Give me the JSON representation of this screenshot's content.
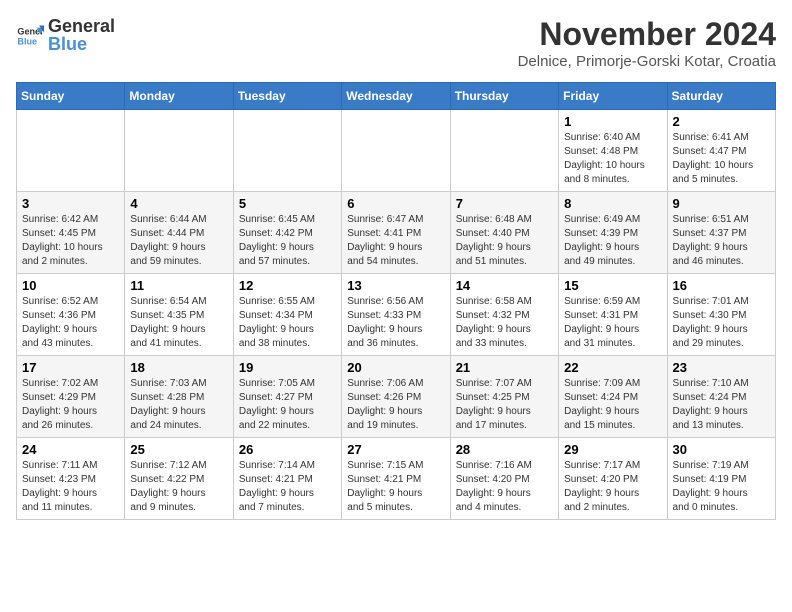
{
  "header": {
    "logo_general": "General",
    "logo_blue": "Blue",
    "month_title": "November 2024",
    "location": "Delnice, Primorje-Gorski Kotar, Croatia"
  },
  "weekdays": [
    "Sunday",
    "Monday",
    "Tuesday",
    "Wednesday",
    "Thursday",
    "Friday",
    "Saturday"
  ],
  "weeks": [
    [
      {
        "day": "",
        "info": ""
      },
      {
        "day": "",
        "info": ""
      },
      {
        "day": "",
        "info": ""
      },
      {
        "day": "",
        "info": ""
      },
      {
        "day": "",
        "info": ""
      },
      {
        "day": "1",
        "info": "Sunrise: 6:40 AM\nSunset: 4:48 PM\nDaylight: 10 hours\nand 8 minutes."
      },
      {
        "day": "2",
        "info": "Sunrise: 6:41 AM\nSunset: 4:47 PM\nDaylight: 10 hours\nand 5 minutes."
      }
    ],
    [
      {
        "day": "3",
        "info": "Sunrise: 6:42 AM\nSunset: 4:45 PM\nDaylight: 10 hours\nand 2 minutes."
      },
      {
        "day": "4",
        "info": "Sunrise: 6:44 AM\nSunset: 4:44 PM\nDaylight: 9 hours\nand 59 minutes."
      },
      {
        "day": "5",
        "info": "Sunrise: 6:45 AM\nSunset: 4:42 PM\nDaylight: 9 hours\nand 57 minutes."
      },
      {
        "day": "6",
        "info": "Sunrise: 6:47 AM\nSunset: 4:41 PM\nDaylight: 9 hours\nand 54 minutes."
      },
      {
        "day": "7",
        "info": "Sunrise: 6:48 AM\nSunset: 4:40 PM\nDaylight: 9 hours\nand 51 minutes."
      },
      {
        "day": "8",
        "info": "Sunrise: 6:49 AM\nSunset: 4:39 PM\nDaylight: 9 hours\nand 49 minutes."
      },
      {
        "day": "9",
        "info": "Sunrise: 6:51 AM\nSunset: 4:37 PM\nDaylight: 9 hours\nand 46 minutes."
      }
    ],
    [
      {
        "day": "10",
        "info": "Sunrise: 6:52 AM\nSunset: 4:36 PM\nDaylight: 9 hours\nand 43 minutes."
      },
      {
        "day": "11",
        "info": "Sunrise: 6:54 AM\nSunset: 4:35 PM\nDaylight: 9 hours\nand 41 minutes."
      },
      {
        "day": "12",
        "info": "Sunrise: 6:55 AM\nSunset: 4:34 PM\nDaylight: 9 hours\nand 38 minutes."
      },
      {
        "day": "13",
        "info": "Sunrise: 6:56 AM\nSunset: 4:33 PM\nDaylight: 9 hours\nand 36 minutes."
      },
      {
        "day": "14",
        "info": "Sunrise: 6:58 AM\nSunset: 4:32 PM\nDaylight: 9 hours\nand 33 minutes."
      },
      {
        "day": "15",
        "info": "Sunrise: 6:59 AM\nSunset: 4:31 PM\nDaylight: 9 hours\nand 31 minutes."
      },
      {
        "day": "16",
        "info": "Sunrise: 7:01 AM\nSunset: 4:30 PM\nDaylight: 9 hours\nand 29 minutes."
      }
    ],
    [
      {
        "day": "17",
        "info": "Sunrise: 7:02 AM\nSunset: 4:29 PM\nDaylight: 9 hours\nand 26 minutes."
      },
      {
        "day": "18",
        "info": "Sunrise: 7:03 AM\nSunset: 4:28 PM\nDaylight: 9 hours\nand 24 minutes."
      },
      {
        "day": "19",
        "info": "Sunrise: 7:05 AM\nSunset: 4:27 PM\nDaylight: 9 hours\nand 22 minutes."
      },
      {
        "day": "20",
        "info": "Sunrise: 7:06 AM\nSunset: 4:26 PM\nDaylight: 9 hours\nand 19 minutes."
      },
      {
        "day": "21",
        "info": "Sunrise: 7:07 AM\nSunset: 4:25 PM\nDaylight: 9 hours\nand 17 minutes."
      },
      {
        "day": "22",
        "info": "Sunrise: 7:09 AM\nSunset: 4:24 PM\nDaylight: 9 hours\nand 15 minutes."
      },
      {
        "day": "23",
        "info": "Sunrise: 7:10 AM\nSunset: 4:24 PM\nDaylight: 9 hours\nand 13 minutes."
      }
    ],
    [
      {
        "day": "24",
        "info": "Sunrise: 7:11 AM\nSunset: 4:23 PM\nDaylight: 9 hours\nand 11 minutes."
      },
      {
        "day": "25",
        "info": "Sunrise: 7:12 AM\nSunset: 4:22 PM\nDaylight: 9 hours\nand 9 minutes."
      },
      {
        "day": "26",
        "info": "Sunrise: 7:14 AM\nSunset: 4:21 PM\nDaylight: 9 hours\nand 7 minutes."
      },
      {
        "day": "27",
        "info": "Sunrise: 7:15 AM\nSunset: 4:21 PM\nDaylight: 9 hours\nand 5 minutes."
      },
      {
        "day": "28",
        "info": "Sunrise: 7:16 AM\nSunset: 4:20 PM\nDaylight: 9 hours\nand 4 minutes."
      },
      {
        "day": "29",
        "info": "Sunrise: 7:17 AM\nSunset: 4:20 PM\nDaylight: 9 hours\nand 2 minutes."
      },
      {
        "day": "30",
        "info": "Sunrise: 7:19 AM\nSunset: 4:19 PM\nDaylight: 9 hours\nand 0 minutes."
      }
    ]
  ]
}
